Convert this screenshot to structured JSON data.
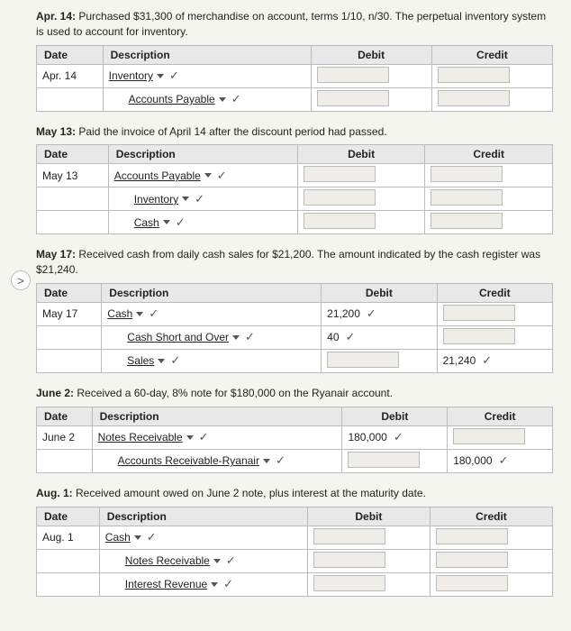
{
  "sections": [
    {
      "id": "apr14",
      "intro": "Apr. 14: Purchased $31,300 of merchandise on account, terms 1/10, n/30. The perpetual inventory system is used to account for inventory.",
      "table": {
        "headers": [
          "Date",
          "Description",
          "Debit",
          "Credit"
        ],
        "rows": [
          {
            "date": "Apr. 14",
            "desc": "Inventory",
            "debit": "",
            "credit": "",
            "indent": false
          },
          {
            "date": "",
            "desc": "Accounts Payable",
            "debit": "",
            "credit": "",
            "indent": true
          }
        ]
      }
    },
    {
      "id": "may13",
      "intro": "May 13: Paid the invoice of April 14 after the discount period had passed.",
      "table": {
        "headers": [
          "Date",
          "Description",
          "Debit",
          "Credit"
        ],
        "rows": [
          {
            "date": "May 13",
            "desc": "Accounts Payable",
            "debit": "",
            "credit": "",
            "indent": false
          },
          {
            "date": "",
            "desc": "Inventory",
            "debit": "",
            "credit": "",
            "indent": true
          },
          {
            "date": "",
            "desc": "Cash",
            "debit": "",
            "credit": "",
            "indent": true
          }
        ]
      }
    },
    {
      "id": "may17",
      "intro": "May 17: Received cash from daily cash sales for $21,200. The amount indicated by the cash register was $21,240.",
      "table": {
        "headers": [
          "Date",
          "Description",
          "Debit",
          "Credit"
        ],
        "rows": [
          {
            "date": "May 17",
            "desc": "Cash",
            "debit": "21,200",
            "credit": "",
            "indent": false
          },
          {
            "date": "",
            "desc": "Cash Short and Over",
            "debit": "40",
            "credit": "",
            "indent": true
          },
          {
            "date": "",
            "desc": "Sales",
            "debit": "",
            "credit": "21,240",
            "indent": true
          }
        ]
      }
    },
    {
      "id": "jun2",
      "intro": "June 2: Received a 60-day, 8% note for $180,000 on the Ryanair account.",
      "table": {
        "headers": [
          "Date",
          "Description",
          "Debit",
          "Credit"
        ],
        "rows": [
          {
            "date": "June 2",
            "desc": "Notes Receivable",
            "debit": "180,000",
            "credit": "",
            "indent": false
          },
          {
            "date": "",
            "desc": "Accounts Receivable-Ryanair",
            "debit": "",
            "credit": "180,000",
            "indent": true
          }
        ]
      }
    },
    {
      "id": "aug1",
      "intro": "Aug. 1: Received amount owed on June 2 note, plus interest at the maturity date.",
      "table": {
        "headers": [
          "Date",
          "Description",
          "Debit",
          "Credit"
        ],
        "rows": [
          {
            "date": "Aug. 1",
            "desc": "Cash",
            "debit": "",
            "credit": "",
            "indent": false
          },
          {
            "date": "",
            "desc": "Notes Receivable",
            "debit": "",
            "credit": "",
            "indent": true
          },
          {
            "date": "",
            "desc": "Interest Revenue",
            "debit": "",
            "credit": "",
            "indent": true
          }
        ]
      }
    }
  ],
  "nav": {
    "left_arrow": ">"
  }
}
